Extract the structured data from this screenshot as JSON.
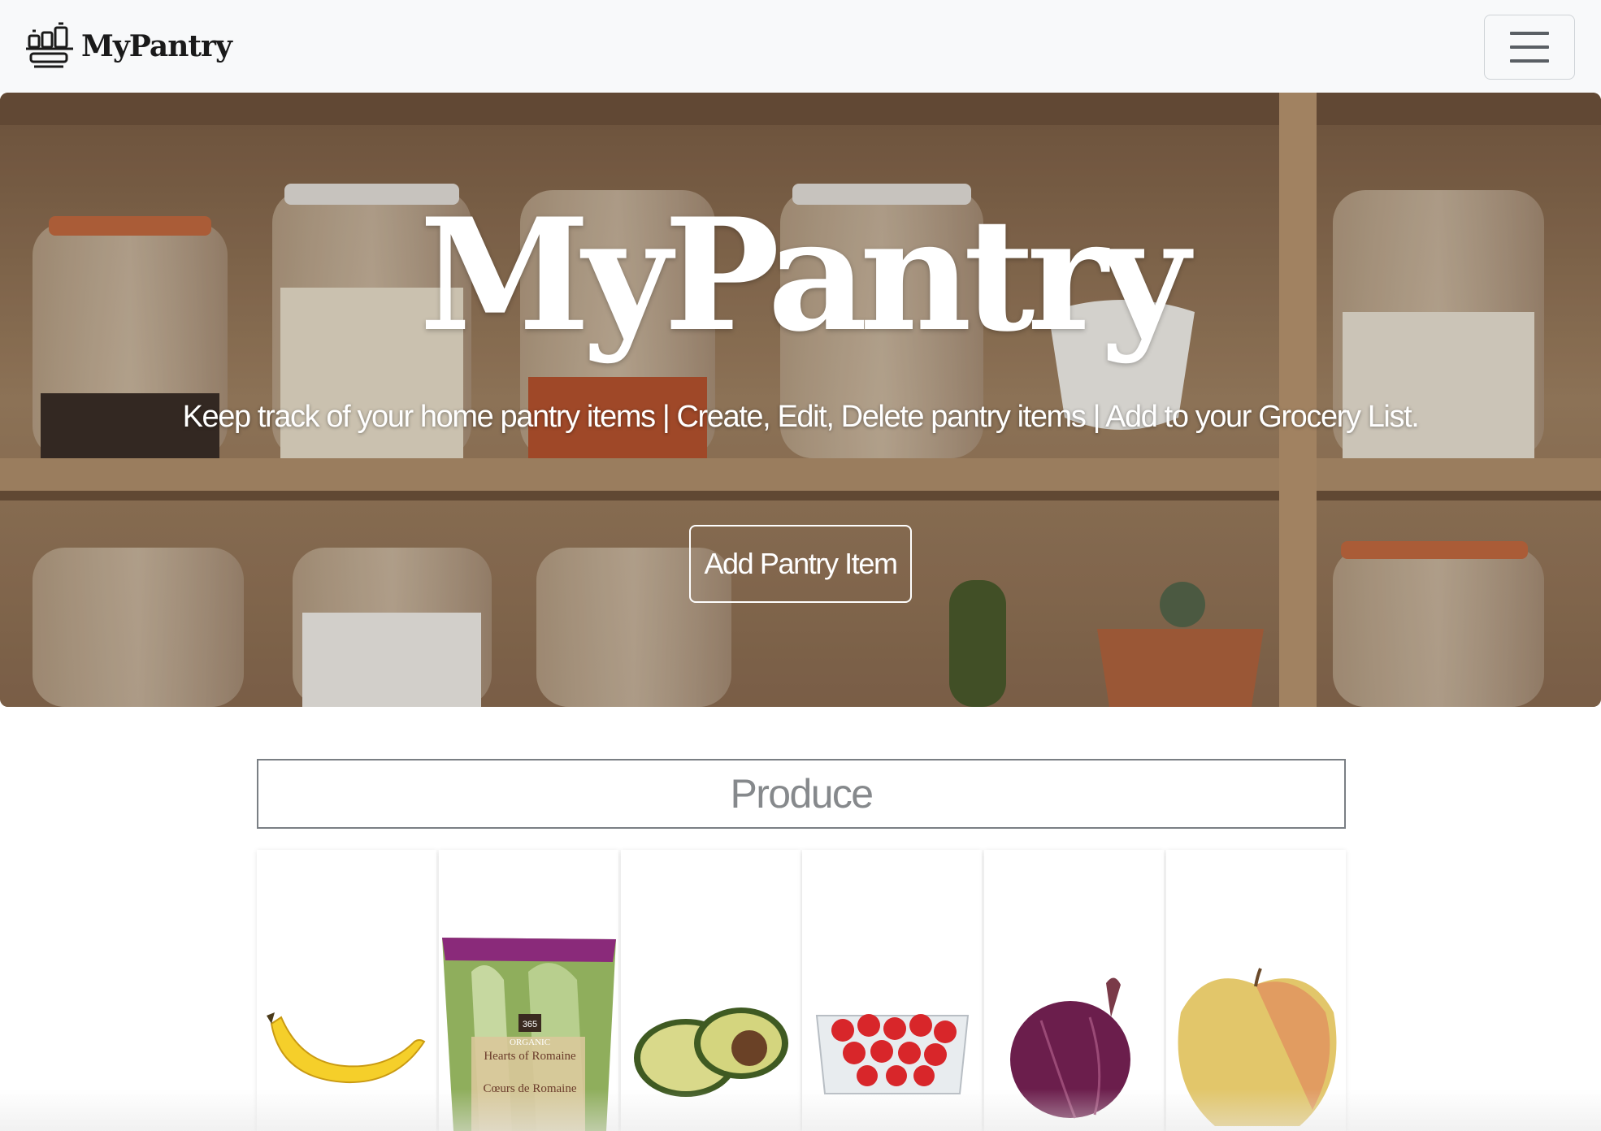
{
  "navbar": {
    "brand": "MyPantry",
    "logo_icon": "pantry-shelf-icon",
    "menu_icon": "hamburger-menu-icon"
  },
  "hero": {
    "title": "MyPantry",
    "subtitle": "Keep track of your home pantry items | Create, Edit, Delete pantry items | Add to your Grocery List.",
    "button_label": "Add Pantry Item"
  },
  "produce": {
    "heading": "Produce",
    "items": [
      {
        "icon": "banana-icon"
      },
      {
        "icon": "romaine-lettuce-icon",
        "package_brand": "365",
        "package_tag": "ORGANIC",
        "package_name": "Hearts of Romaine",
        "package_name_fr": "Cœurs de Romaine"
      },
      {
        "icon": "avocado-icon"
      },
      {
        "icon": "strawberries-icon"
      },
      {
        "icon": "red-onion-icon"
      },
      {
        "icon": "apple-icon"
      }
    ]
  },
  "colors": {
    "navbar_bg": "#f8f9fa",
    "hero_wood": "#9c7b5c",
    "section_border": "#7a7f84",
    "section_text": "#86898c"
  }
}
